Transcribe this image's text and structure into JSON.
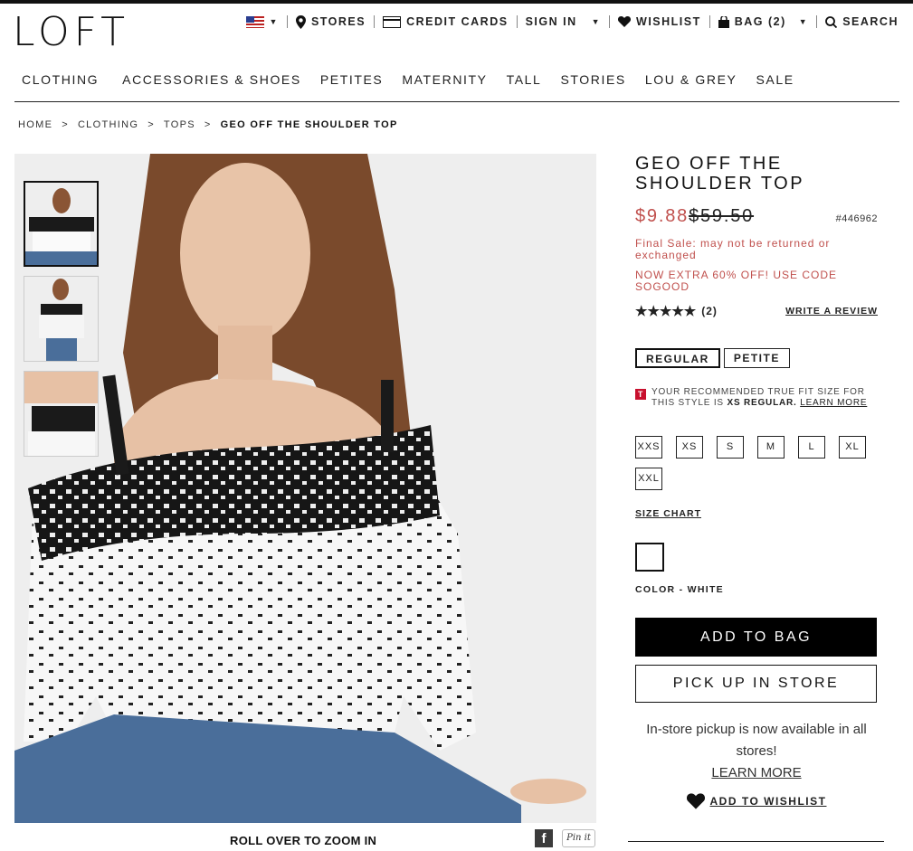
{
  "brand": "LOFT",
  "util": {
    "stores": "STORES",
    "credit_cards": "CREDIT CARDS",
    "sign_in": "SIGN IN",
    "wishlist": "WISHLIST",
    "bag": "BAG (2)",
    "search": "SEARCH"
  },
  "nav": [
    "CLOTHING",
    "ACCESSORIES & SHOES",
    "PETITES",
    "MATERNITY",
    "TALL",
    "STORIES",
    "LOU & GREY",
    "SALE"
  ],
  "breadcrumb": {
    "home": "HOME",
    "clothing": "CLOTHING",
    "tops": "TOPS",
    "current": "GEO OFF THE SHOULDER TOP",
    "sep": ">"
  },
  "gallery": {
    "zoom_hint": "ROLL OVER TO ZOOM IN",
    "pin": "Pin it",
    "fb": "f"
  },
  "product": {
    "title": "GEO OFF THE SHOULDER TOP",
    "sale_price": "$9.88",
    "orig_price": "$59.50",
    "sku": "#446962",
    "final_sale": "Final Sale: may not be returned or exchanged",
    "promo": "NOW EXTRA 60% OFF! USE CODE SOGOOD",
    "stars": "★★★★★",
    "review_count": "(2)",
    "write_review": "WRITE A REVIEW",
    "fit_options": [
      "REGULAR",
      "PETITE"
    ],
    "truefit_text": "YOUR RECOMMENDED TRUE FIT SIZE FOR THIS STYLE IS",
    "truefit_size": "XS REGULAR.",
    "learn_more_small": "LEARN MORE",
    "sizes": [
      "XXS",
      "XS",
      "S",
      "M",
      "L",
      "XL",
      "XXL"
    ],
    "size_chart": "SIZE CHART",
    "color_label": "COLOR - WHITE",
    "add_to_bag": "ADD TO BAG",
    "pick_up": "PICK UP IN STORE",
    "pickup_note": "In-store pickup is now available in all stores!",
    "learn_more": "LEARN MORE",
    "add_to_wishlist": "ADD TO WISHLIST"
  },
  "colors": {
    "sale": "#c0504d",
    "black": "#000000"
  }
}
